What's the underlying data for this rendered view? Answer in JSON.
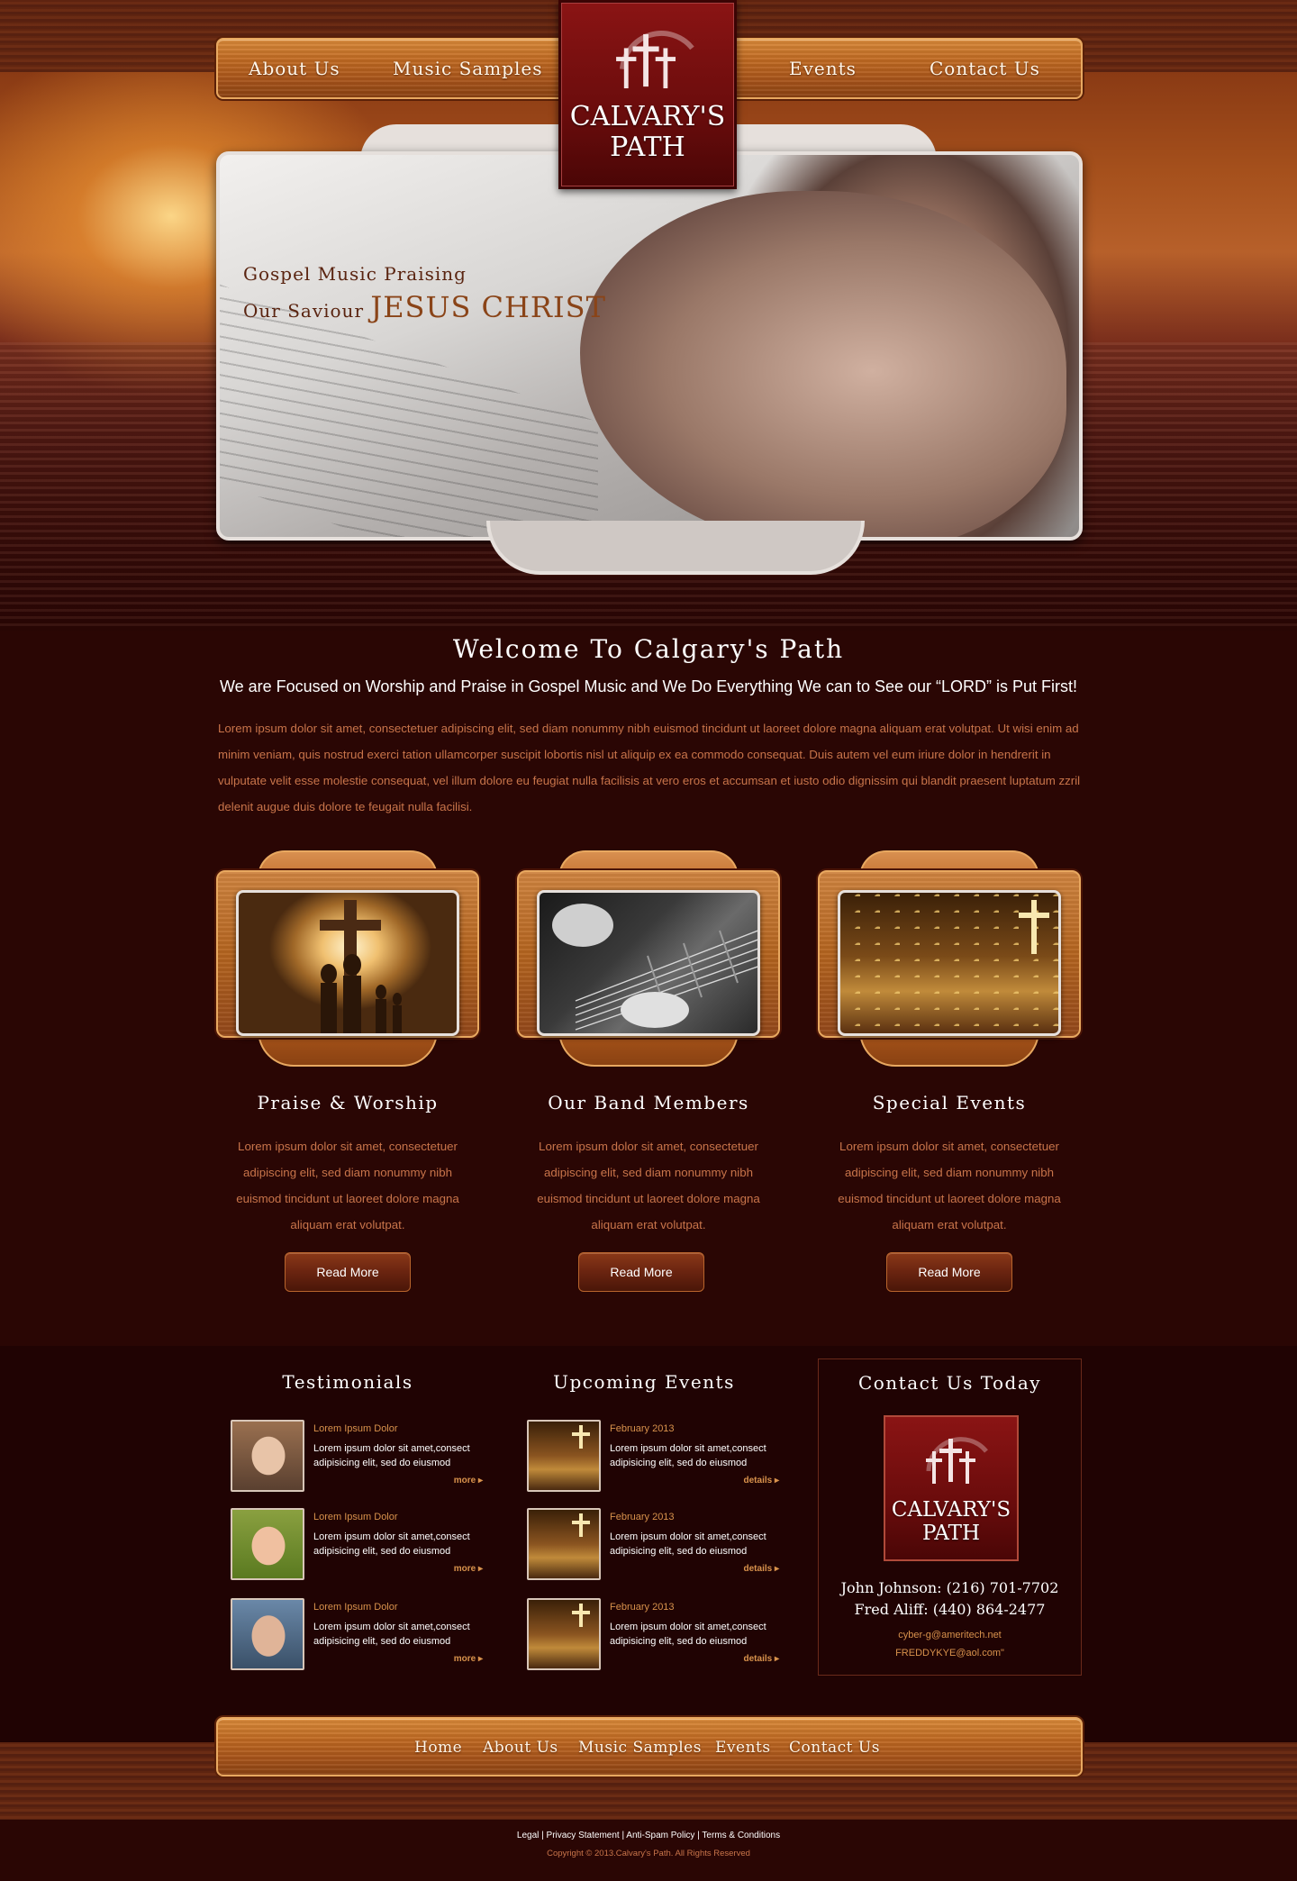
{
  "brand": {
    "logo_line1": "CALVARY'S",
    "logo_line2": "PATH",
    "accent": "#c8744a",
    "wood": "#b4641f",
    "maroon": "#6a0c0c"
  },
  "nav": {
    "items": [
      "About Us",
      "Music Samples",
      "Events",
      "Contact Us"
    ]
  },
  "hero": {
    "line1": "Gospel Music Praising",
    "line2_prefix": "Our Saviour",
    "line2_highlight": "JESUS CHRIST"
  },
  "welcome": {
    "title": "Welcome To Calgary's Path",
    "subtitle": "We are Focused on Worship and Praise in Gospel Music and We Do Everything We can to See our “LORD” is Put First!",
    "body": "Lorem ipsum dolor sit amet, consectetuer adipiscing elit, sed diam nonummy nibh euismod tincidunt ut laoreet dolore magna aliquam erat volutpat. Ut wisi enim ad minim veniam, quis nostrud exerci tation ullamcorper suscipit lobortis nisl ut aliquip ex ea commodo consequat. Duis autem vel eum iriure dolor in hendrerit in vulputate velit esse molestie consequat, vel illum dolore eu feugiat nulla facilisis at vero eros et accumsan et iusto odio dignissim qui blandit praesent luptatum zzril delenit augue duis dolore te feugait nulla facilisi."
  },
  "features": [
    {
      "title": "Praise & Worship",
      "text": "Lorem ipsum dolor sit amet, consectetuer adipiscing elit, sed diam nonummy nibh euismod tincidunt ut laoreet dolore magna aliquam erat volutpat.",
      "button": "Read More"
    },
    {
      "title": "Our Band Members",
      "text": "Lorem ipsum dolor sit amet, consectetuer adipiscing elit, sed diam nonummy nibh euismod tincidunt ut laoreet dolore magna aliquam erat volutpat.",
      "button": "Read More"
    },
    {
      "title": "Special Events",
      "text": "Lorem ipsum dolor sit amet, consectetuer adipiscing elit, sed diam nonummy nibh euismod tincidunt ut laoreet dolore magna aliquam erat volutpat.",
      "button": "Read More"
    }
  ],
  "testimonials": {
    "title": "Testimonials",
    "items": [
      {
        "name": "Lorem Ipsum Dolor",
        "text": "Lorem ipsum dolor sit amet,consect adipisicing elit, sed do eiusmod",
        "more": "more ▸"
      },
      {
        "name": "Lorem Ipsum Dolor",
        "text": "Lorem ipsum dolor sit amet,consect adipisicing elit, sed do eiusmod",
        "more": "more ▸"
      },
      {
        "name": "Lorem Ipsum Dolor",
        "text": "Lorem ipsum dolor sit amet,consect adipisicing elit, sed do eiusmod",
        "more": "more ▸"
      }
    ]
  },
  "events": {
    "title": "Upcoming Events",
    "items": [
      {
        "date": "February 2013",
        "text": "Lorem ipsum dolor sit amet,consect adipisicing elit, sed do eiusmod",
        "more": "details ▸"
      },
      {
        "date": "February 2013",
        "text": "Lorem ipsum dolor sit amet,consect adipisicing elit, sed do eiusmod",
        "more": "details ▸"
      },
      {
        "date": "February 2013",
        "text": "Lorem ipsum dolor sit amet,consect adipisicing elit, sed do eiusmod",
        "more": "details ▸"
      }
    ]
  },
  "contact": {
    "title": "Contact Us Today",
    "line1": "John Johnson: (216) 701-7702",
    "line2": "Fred Aliff: (440) 864-2477",
    "email1": "cyber-g@ameritech.net",
    "email2": "FREDDYKYE@aol.com\""
  },
  "footer_nav": [
    "Home",
    "About Us",
    "Music Samples",
    "Events",
    "Contact Us"
  ],
  "legal": "Legal | Privacy Statement | Anti-Spam Policy | Terms & Conditions",
  "copyright": "Copyright © 2013.Calvary's Path. All Rights Reserved"
}
